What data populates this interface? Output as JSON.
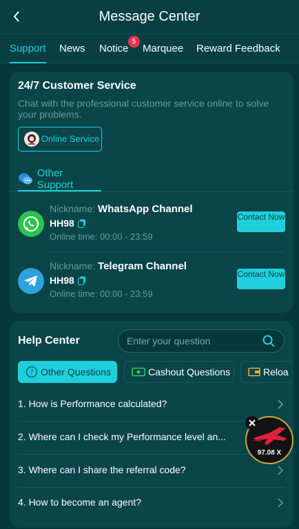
{
  "header": {
    "title": "Message Center"
  },
  "tabs": [
    {
      "label": "Support"
    },
    {
      "label": "News"
    },
    {
      "label": "Notice",
      "badge": "5"
    },
    {
      "label": "Marquee"
    },
    {
      "label": "Reward Feedback"
    }
  ],
  "customer_service": {
    "title": "24/7 Customer Service",
    "description": "Chat with the professional customer service online to solve your problems.",
    "online_button": "Online Service",
    "other_support_tab": "Other Support"
  },
  "channels": [
    {
      "nick_label": "Nickname:",
      "name": "WhatsApp Channel",
      "id": "HH98",
      "time": "Online time: 00:00 - 23:59",
      "contact": "Contact Now",
      "icon": "whatsapp-icon"
    },
    {
      "nick_label": "Nickname:",
      "name": "Telegram Channel",
      "id": "HH98",
      "time": "Online time: 00:00 - 23:59",
      "contact": "Contact Now",
      "icon": "telegram-icon"
    }
  ],
  "help": {
    "title": "Help Center",
    "search_placeholder": "Enter your question",
    "categories": [
      {
        "label": "Other Questions",
        "active": true
      },
      {
        "label": "Cashout Questions",
        "active": false
      },
      {
        "label": "Reloa",
        "active": false
      }
    ],
    "faqs": [
      "1. How is Performance calculated?",
      "2. Where can I check my Performance level an...",
      "3. Where can I share the referral code?",
      "4. How to become an agent?"
    ]
  },
  "floating_game": {
    "multiplier": "97.08 X"
  },
  "colors": {
    "accent": "#1fd0dc",
    "background": "#06373a",
    "card": "#0a4549",
    "badge": "#e8354c"
  }
}
